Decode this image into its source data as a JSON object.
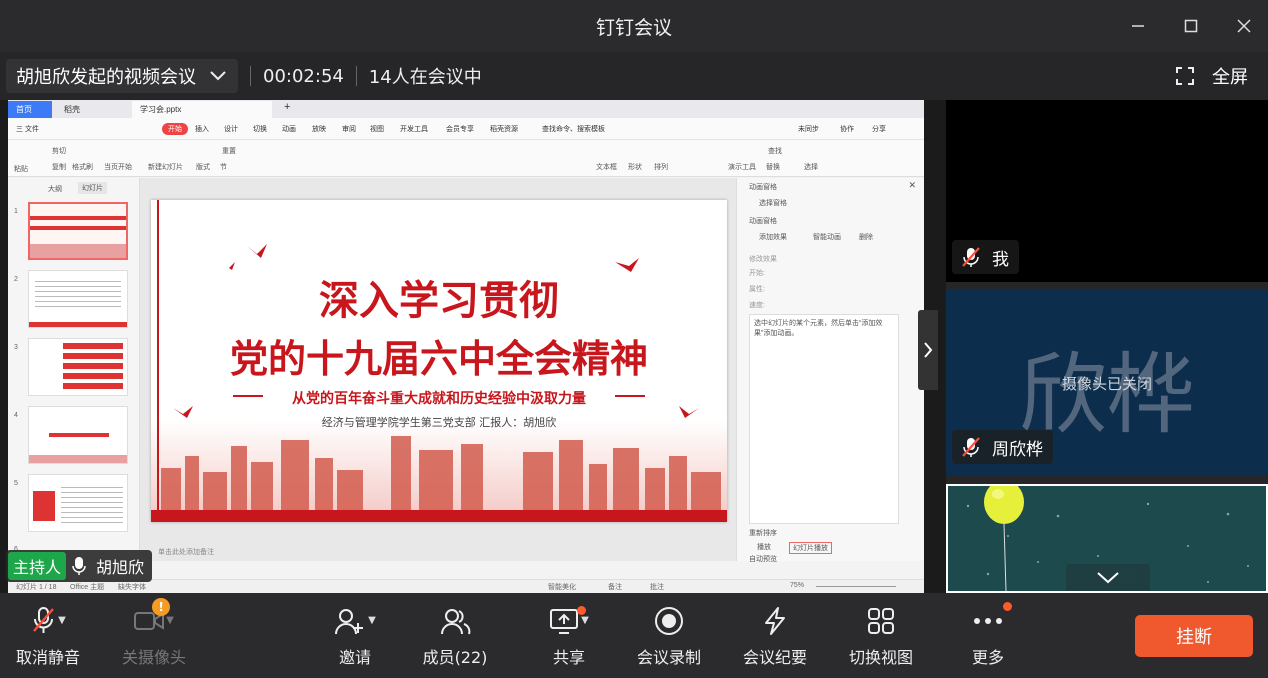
{
  "window": {
    "title": "钉钉会议"
  },
  "meeting": {
    "name": "胡旭欣发起的视频会议",
    "duration": "00:02:54",
    "participants_text": "14人在会议中",
    "fullscreen_label": "全屏"
  },
  "shared_screen": {
    "tabs": [
      "首页",
      "稻壳",
      "学习会.pptx"
    ],
    "menu": [
      "三 文件",
      "开始",
      "插入",
      "设计",
      "切换",
      "动画",
      "放映",
      "审阅",
      "视图",
      "开发工具",
      "会员专享",
      "稻壳资源",
      "查找命令、搜索模板",
      "未同步",
      "协作",
      "分享"
    ],
    "ribbon": [
      "粘贴",
      "剪切",
      "复制",
      "格式刷",
      "当页开始",
      "新建幻灯片",
      "版式",
      "节",
      "重置",
      "文本框",
      "形状",
      "排列",
      "演示工具",
      "替换",
      "选择",
      "查找"
    ],
    "outline_tabs": [
      "大纲",
      "幻灯片"
    ],
    "slide_numbers": [
      "1",
      "2",
      "3",
      "4",
      "5",
      "6"
    ],
    "slide": {
      "title_line1": "深入学习贯彻",
      "title_line2": "党的十九届六中全会精神",
      "subtitle": "从党的百年奋斗重大成就和历史经验中汲取力量",
      "reporter": "经济与管理学院学生第三党支部    汇报人：胡旭欣"
    },
    "anim_pane": {
      "title": "动画窗格",
      "select_pane": "选择窗格",
      "pane_name": "动画窗格",
      "add_effect": "添加效果",
      "smart_anim": "智能动画",
      "delete": "删除",
      "modify": "修改效果",
      "start": "开始:",
      "property": "属性:",
      "speed": "速度:",
      "hint": "选中幻灯片的某个元素，然后单击“添加效果”添加动画。",
      "reorder": "重新排序",
      "play": "播放",
      "slideshow": "幻灯片播放",
      "autopreview": "自动预览"
    },
    "notes_placeholder": "单击此处添加备注",
    "status": {
      "slide_count": "幻灯片 1 / 18",
      "theme": "Office 主题",
      "missing_font": "缺失字体",
      "beautify": "智能美化",
      "notes": "备注",
      "comments": "批注",
      "zoom": "75%"
    }
  },
  "videos": [
    {
      "name": "我",
      "muted": true
    },
    {
      "name": "周欣桦",
      "muted": true,
      "big_name": "欣桦",
      "camera_off_text": "摄像头已关闭"
    },
    {
      "name": "",
      "muted": false
    }
  ],
  "host": {
    "badge": "主持人",
    "name": "胡旭欣"
  },
  "toolbar": {
    "unmute": "取消静音",
    "camera": "关摄像头",
    "invite": "邀请",
    "members": "成员(22)",
    "share": "共享",
    "record": "会议录制",
    "minutes": "会议纪要",
    "switch_view": "切换视图",
    "more": "更多",
    "hangup": "挂断",
    "camera_alert": "!"
  },
  "colors": {
    "accent": "#f0592e",
    "host_badge": "#1ea64a",
    "slide_red": "#c8161d"
  }
}
